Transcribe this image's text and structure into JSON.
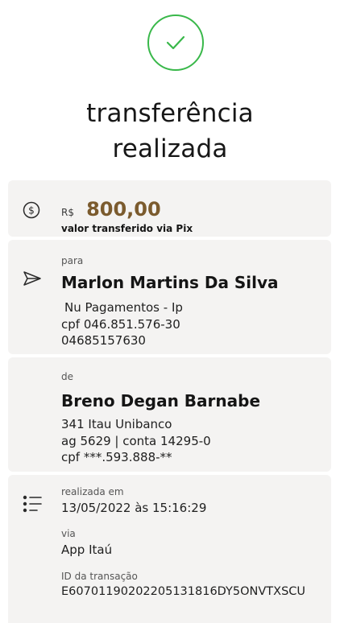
{
  "header": {
    "status_icon": "check-circle-icon",
    "title_line1": "transferência",
    "title_line2": "realizada",
    "accent_color": "#39b84a"
  },
  "amount": {
    "icon": "dollar-circle-icon",
    "currency": "R$",
    "value": "800,00",
    "caption": "valor transferido via Pix",
    "value_color": "#7b5b2e"
  },
  "recipient": {
    "icon": "send-icon",
    "label": "para",
    "name": "Marlon Martins Da Silva",
    "bank": "Nu Pagamentos - Ip",
    "cpf": "cpf 046.851.576-30",
    "account": "04685157630"
  },
  "sender": {
    "label": "de",
    "name": "Breno Degan Barnabe",
    "bank": "341 Itau Unibanco",
    "account": "ag 5629 | conta 14295-0",
    "cpf": "cpf ***.593.888-**"
  },
  "details": {
    "icon": "list-icon",
    "date_label": "realizada em",
    "date_value": "13/05/2022 às 15:16:29",
    "via_label": "via",
    "via_value": "App Itaú",
    "id_label": "ID da transação",
    "id_value": "E60701190202205131816DY5ONVTXSCU"
  }
}
